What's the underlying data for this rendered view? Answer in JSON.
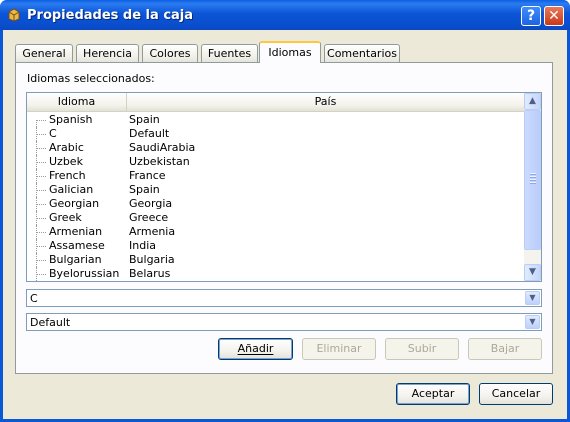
{
  "window": {
    "title": "Propiedades de la caja",
    "help_glyph": "?",
    "close_glyph": "✕",
    "help_color": "#2f78ee",
    "close_color": "#d9552f"
  },
  "tabs": [
    {
      "label": "General",
      "active": false
    },
    {
      "label": "Herencia",
      "active": false
    },
    {
      "label": "Colores",
      "active": false
    },
    {
      "label": "Fuentes",
      "active": false
    },
    {
      "label": "Idiomas",
      "active": true
    },
    {
      "label": "Comentarios",
      "active": false
    }
  ],
  "languages_panel": {
    "selected_label": "Idiomas seleccionados:",
    "columns": {
      "language": "Idioma",
      "country": "País"
    },
    "rows": [
      {
        "language": "Spanish",
        "country": "Spain"
      },
      {
        "language": "C",
        "country": "Default"
      },
      {
        "language": "Arabic",
        "country": "SaudiArabia"
      },
      {
        "language": "Uzbek",
        "country": "Uzbekistan"
      },
      {
        "language": "French",
        "country": "France"
      },
      {
        "language": "Galician",
        "country": "Spain"
      },
      {
        "language": "Georgian",
        "country": "Georgia"
      },
      {
        "language": "Greek",
        "country": "Greece"
      },
      {
        "language": "Armenian",
        "country": "Armenia"
      },
      {
        "language": "Assamese",
        "country": "India"
      },
      {
        "language": "Bulgarian",
        "country": "Bulgaria"
      },
      {
        "language": "Byelorussian",
        "country": "Belarus"
      }
    ],
    "language_combo": "C",
    "country_combo": "Default",
    "buttons": {
      "add": "Añadir",
      "remove": "Eliminar",
      "up": "Subir",
      "down": "Bajar"
    }
  },
  "footer": {
    "accept": "Aceptar",
    "cancel": "Cancelar"
  },
  "icons": {
    "scroll_up": "▲",
    "scroll_down": "▼",
    "combo_arrow": "▼"
  }
}
